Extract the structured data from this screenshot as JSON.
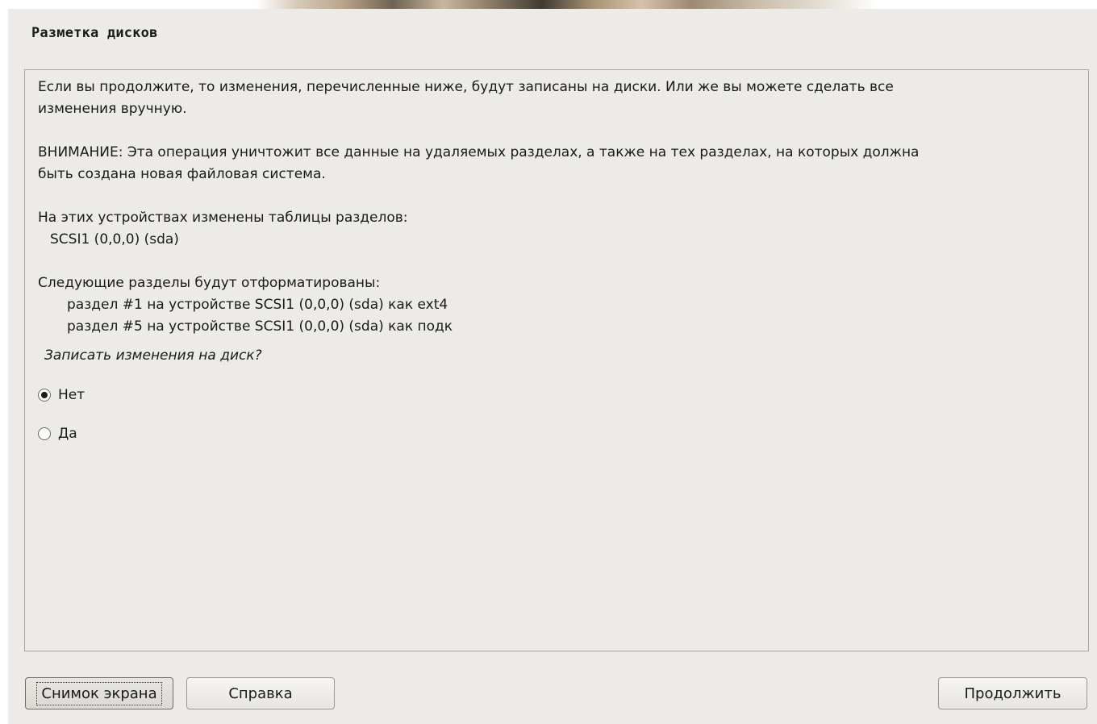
{
  "dialog": {
    "title": "Разметка дисков"
  },
  "content": {
    "para1": [
      "Если вы продолжите, то изменения, перечисленные ниже, будут записаны на диски. Или же вы можете сделать все",
      "изменения вручную."
    ],
    "para2": [
      "ВНИМАНИЕ: Эта операция уничтожит все данные на удаляемых разделах, а также на тех разделах, на которых должна",
      "быть создана новая файловая система."
    ],
    "tables_header": "На этих устройствах изменены таблицы разделов:",
    "tables_device": "SCSI1 (0,0,0) (sda)",
    "format_header": "Следующие разделы будут отформатированы:",
    "format_items": [
      "раздел #1 на устройстве SCSI1 (0,0,0) (sda) как ext4",
      "раздел #5 на устройстве SCSI1 (0,0,0) (sda) как подк"
    ],
    "question": "Записать изменения на диск?"
  },
  "options": [
    {
      "label": "Нет",
      "selected": true
    },
    {
      "label": "Да",
      "selected": false
    }
  ],
  "buttons": {
    "screenshot": "Снимок экрана",
    "help": "Справка",
    "continue": "Продолжить"
  }
}
